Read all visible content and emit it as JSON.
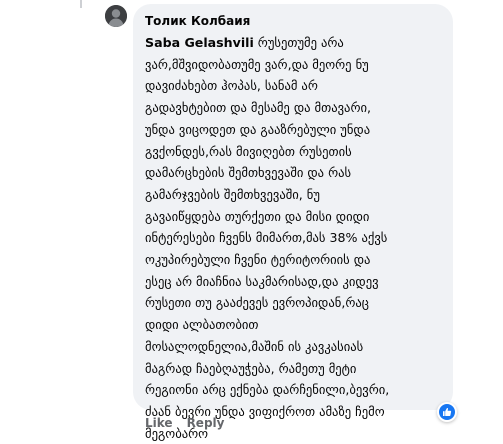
{
  "comment": {
    "author": "Толик Колбаия",
    "mention": "Saba Gelashvili",
    "lines": [
      "რუსეთუმე არა",
      "ვარ,მშვიდობათუმე ვარ,და მეორე ნუ",
      "დავიძახებთ ჰოპას, სანამ არ",
      "გადავხტებით და მესამე და მთავარი,",
      "უნდა ვიცოდეთ და გააზრებული უნდა",
      "გვქონდეს,რას მივიღებთ რუსეთის",
      "დამარცხების შემთხვევაში და რას",
      "გამარჯვების შემთხვევაში, ნუ",
      "გავაიწყდება თურქეთი და მისი დიდი",
      "ინტერესები ჩვენს მიმართ,მას 38% აქვს",
      "ოკუპირებული ჩვენი ტერიტორიის და",
      "ესეც არ მიაჩნია საკმარისად,და კიდევ",
      "რუსეთი თუ გააძევეს ევროპიდან,რაც",
      "დიდი ალბათობით",
      "მოსალოდნელია,მაშინ ის კავკასიას",
      "მაგრად ჩაებღაუჭება, რამეთუ მეტი",
      "რეგიონი არც ექნება დარჩენილი,ბევრი,",
      "ძაან ბევრი უნდა ვიფიქროთ ამაზე ჩემო",
      "მეგობარო"
    ]
  },
  "actions": {
    "like": "Like",
    "reply": "Reply"
  },
  "reaction": {
    "icon": "like-icon",
    "color": "#1877f2"
  },
  "colors": {
    "bubble_bg": "#f0f2f5",
    "text": "#050505",
    "action_text": "#65676b"
  }
}
